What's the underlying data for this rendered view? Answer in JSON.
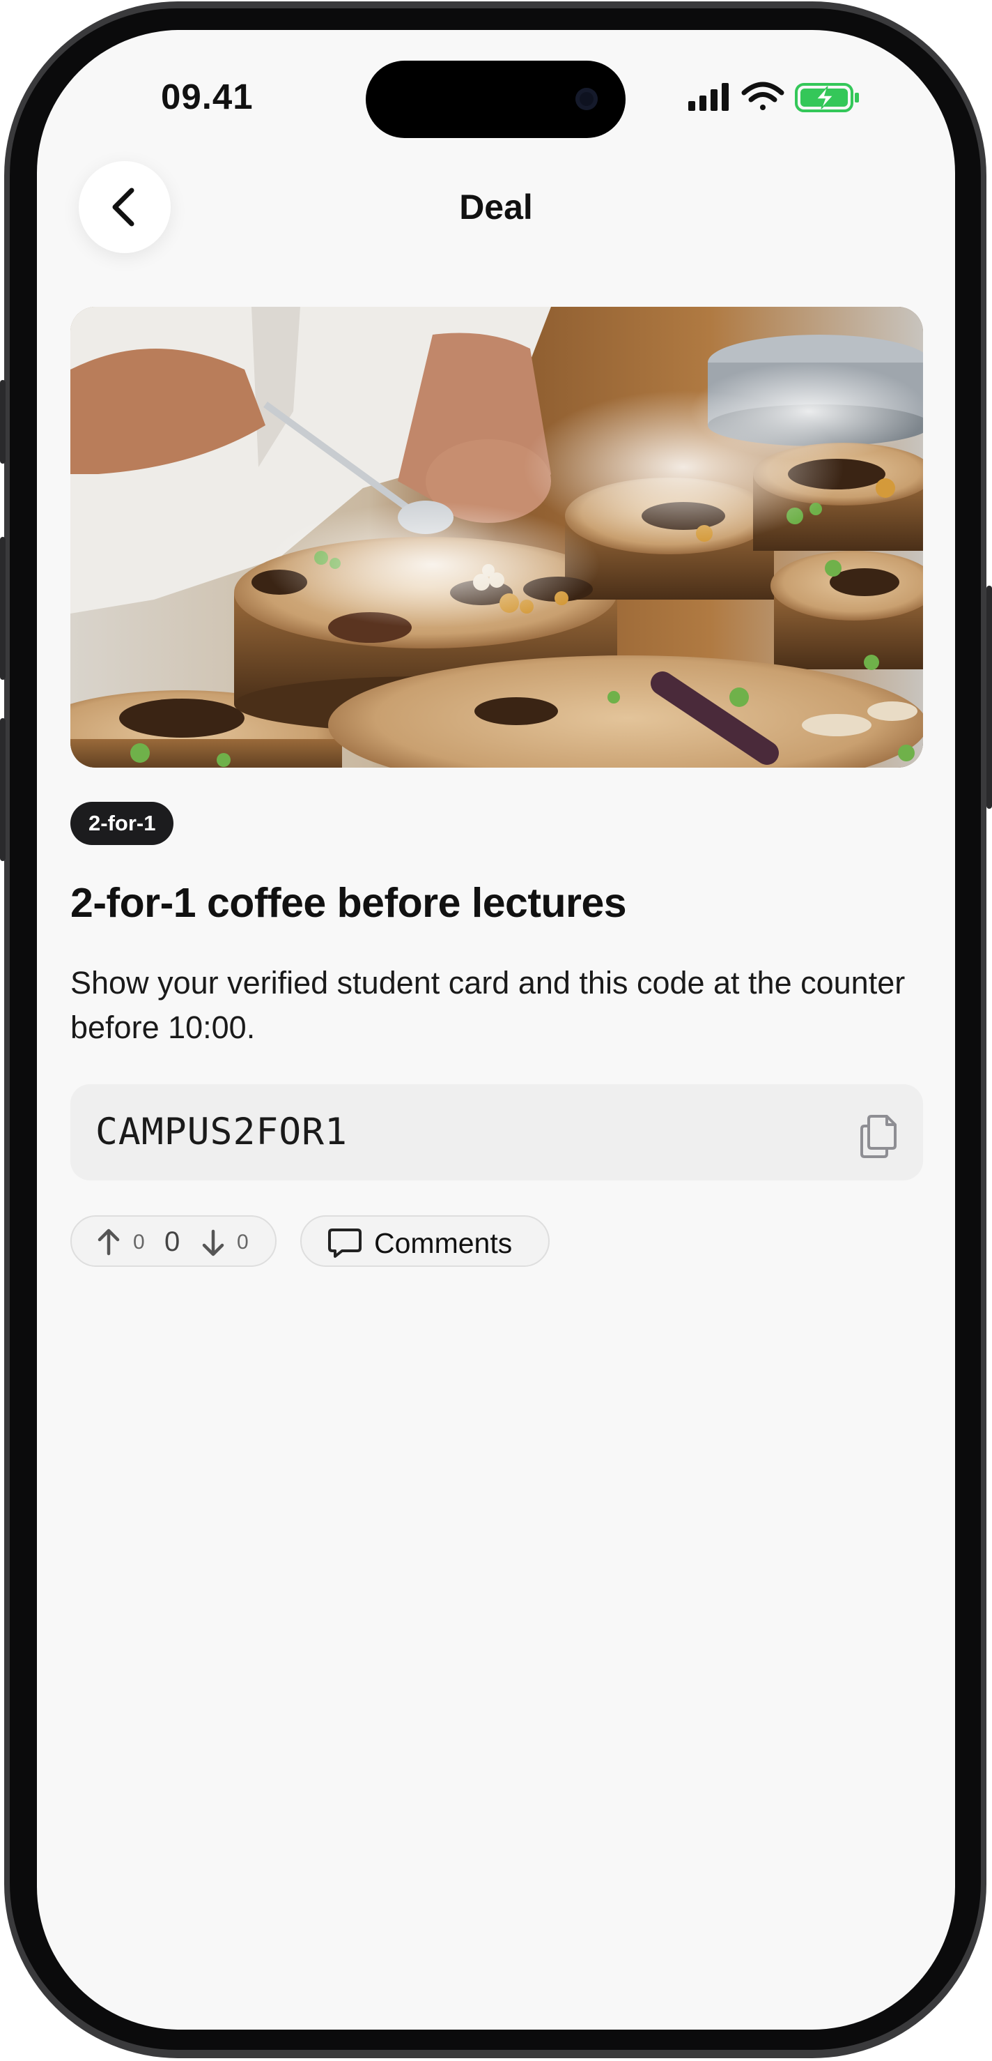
{
  "status_bar": {
    "time": "09.41",
    "icons": [
      "signal-icon",
      "wifi-icon",
      "battery-charging-icon"
    ],
    "battery_color": "#34c759"
  },
  "nav": {
    "title": "Deal",
    "back_icon": "chevron-left-icon"
  },
  "deal": {
    "image_description_icon": "food-photo-image",
    "badge": "2-for-1",
    "title": "2-for-1 coffee before lectures",
    "description": "Show your verified student card and this code at the counter before 10:00.",
    "code": "CAMPUS2FOR1",
    "copy_icon": "copy-icon"
  },
  "actions": {
    "upvotes": "0",
    "score": "0",
    "downvotes": "0",
    "comments_label": "Comments",
    "comments_icon": "chat-bubble-icon"
  },
  "colors": {
    "background": "#f8f8f8",
    "badge_bg": "#1c1c1e",
    "code_box_bg": "#efefef"
  }
}
